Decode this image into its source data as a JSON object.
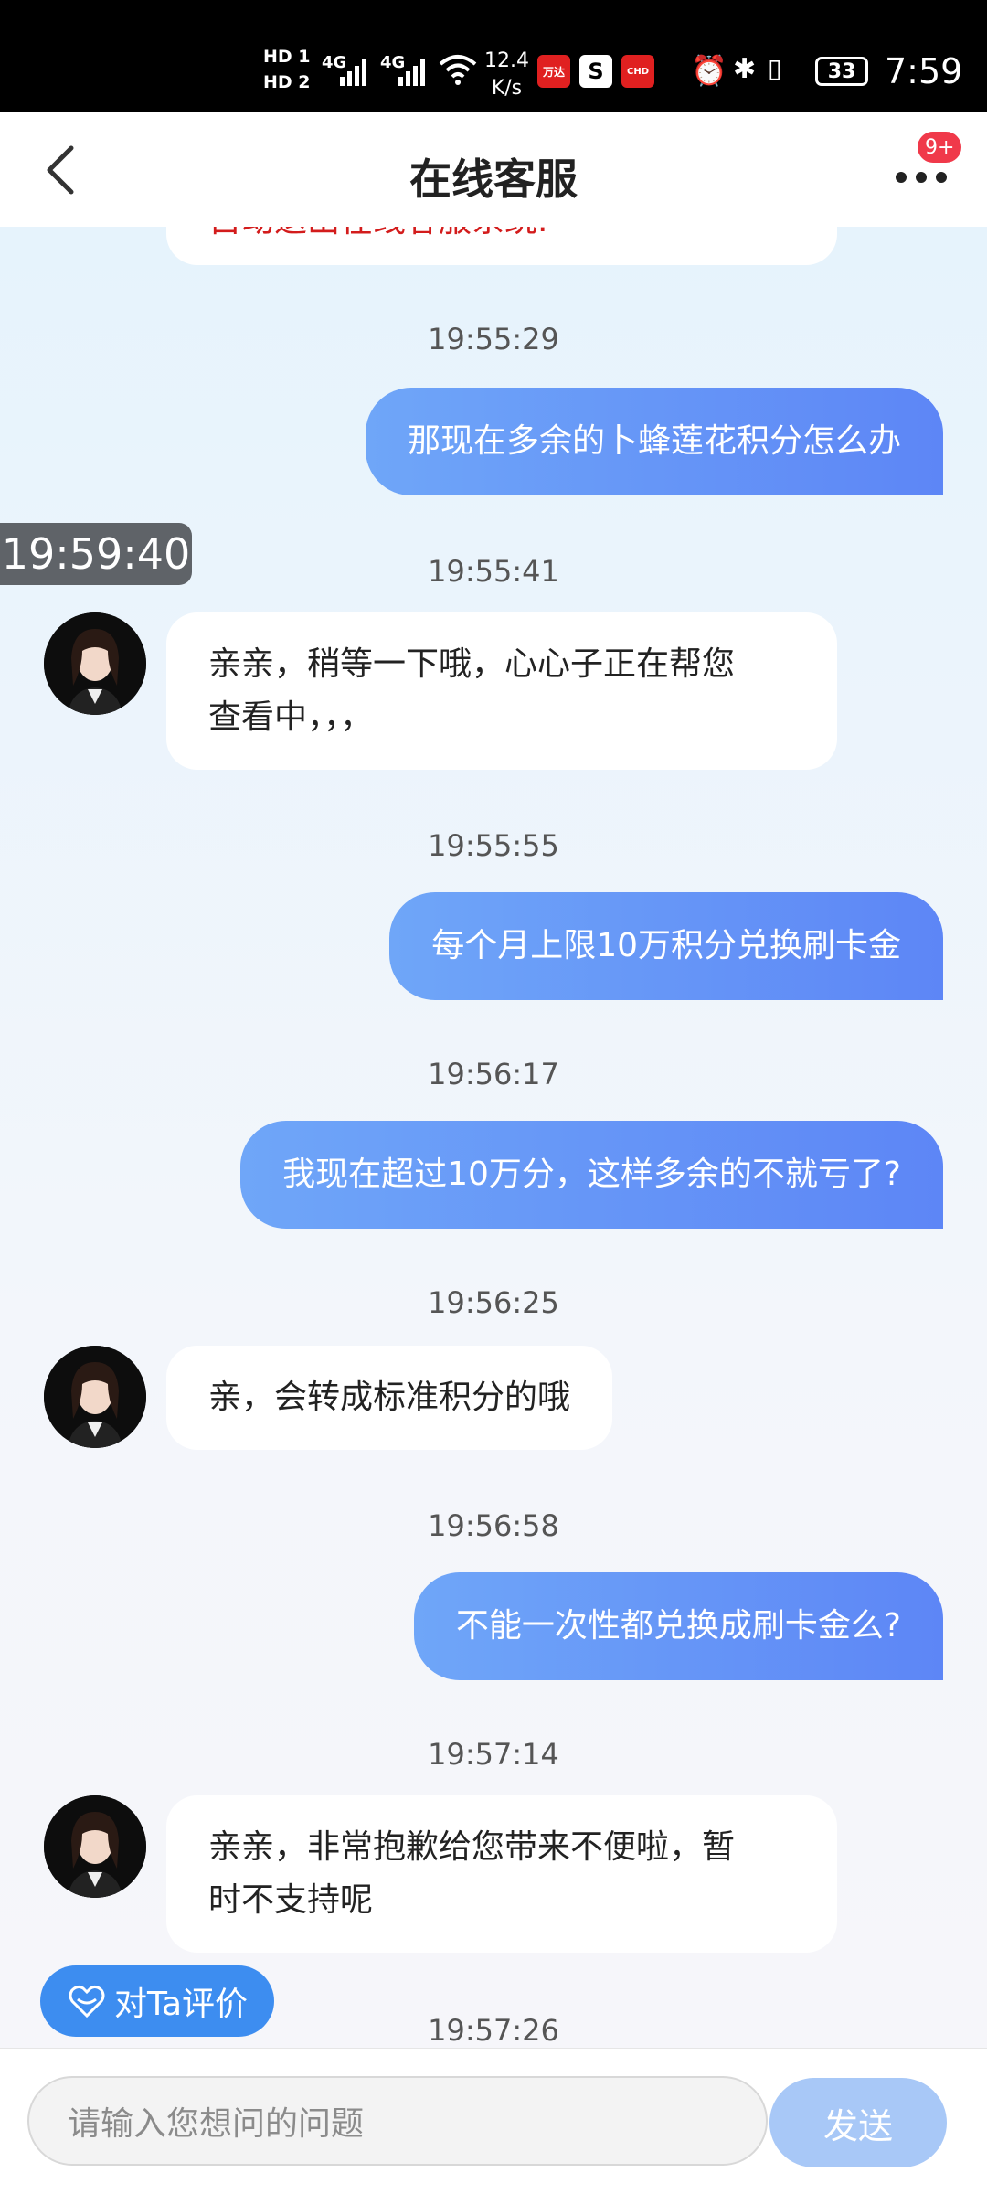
{
  "status_bar": {
    "hd1": "HD 1",
    "hd2": "HD 2",
    "net1": "4G",
    "net2": "4G",
    "speed_value": "12.4",
    "speed_unit": "K/s",
    "app1": "万达",
    "app2": "S",
    "app3": "CHD",
    "battery": "33",
    "time": "7:59"
  },
  "header": {
    "title": "在线客服",
    "badge": "9+"
  },
  "previous_text": "自动退出在线客服系统.",
  "overlay_time": "19:59:40",
  "messages": [
    {
      "time": "19:55:29",
      "side": "right",
      "text": "那现在多余的卜蜂莲花积分怎么办"
    },
    {
      "time": "19:55:41",
      "side": "left",
      "line1": "亲亲，稍等一下哦，心心子正在帮您",
      "line2": "查看中，，，"
    },
    {
      "time": "19:55:55",
      "side": "right",
      "text": "每个月上限10万积分兑换刷卡金"
    },
    {
      "time": "19:56:17",
      "side": "right",
      "text": "我现在超过10万分，这样多余的不就亏了?"
    },
    {
      "time": "19:56:25",
      "side": "left",
      "text": "亲，会转成标准积分的哦"
    },
    {
      "time": "19:56:58",
      "side": "right",
      "text": "不能一次性都兑换成刷卡金么?"
    },
    {
      "time": "19:57:14",
      "side": "left",
      "line1": "亲亲，非常抱歉给您带来不便啦，暂",
      "line2": "时不支持呢"
    },
    {
      "time": "19:57:26"
    }
  ],
  "rate_button": "对Ta评价",
  "input": {
    "placeholder": "请输入您想问的问题",
    "send": "发送"
  },
  "colors": {
    "bubble_gradient_start": "#6fa6f8",
    "bubble_gradient_end": "#5d86f6",
    "accent_blue": "#3d8df0",
    "badge_red": "#f0394a",
    "send_disabled": "#a8c8f7"
  }
}
